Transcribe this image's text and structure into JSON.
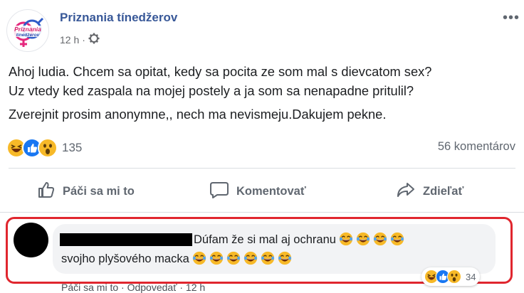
{
  "post": {
    "page_name": "Priznania tínedžerov",
    "logo_text_top": "Priznania",
    "logo_text_bottom": "tínedžerov",
    "time": "12 h",
    "separator": "·",
    "more_label": "•••",
    "text_line_1": "Ahoj ludia. Chcem sa opitat, kedy sa pocita ze som mal s dievcatom sex?",
    "text_line_2": "Uz vtedy ked zaspala na mojej postely a ja som sa nenapadne pritulil?",
    "text_line_3": "Zverejnit prosim anonymne,, nech ma nevismeju.Dakujem pekne.",
    "reaction_count": "135",
    "reactions": [
      "haha",
      "like",
      "wow"
    ],
    "comments_count": "56 komentárov"
  },
  "actions": {
    "like_label": "Páči sa mi to",
    "comment_label": "Komentovať",
    "share_label": "Zdieľať"
  },
  "comment": {
    "author": "[redacted]",
    "line_1": "Dúfam že si mal aj ochranu",
    "line_2": "svojho plyšového macka",
    "line_1_emoji_count": 4,
    "line_2_emoji_count": 6,
    "reactions": [
      "haha",
      "like",
      "wow"
    ],
    "reaction_count": "34",
    "like_label": "Páči sa mi to",
    "reply_label": "Odpovedať",
    "time": "12 h",
    "dot": "·"
  },
  "colors": {
    "brand": "#385898",
    "highlight_frame": "#e0262e",
    "like_blue": "#1877f2",
    "haha_yellow": "#f7b928"
  }
}
